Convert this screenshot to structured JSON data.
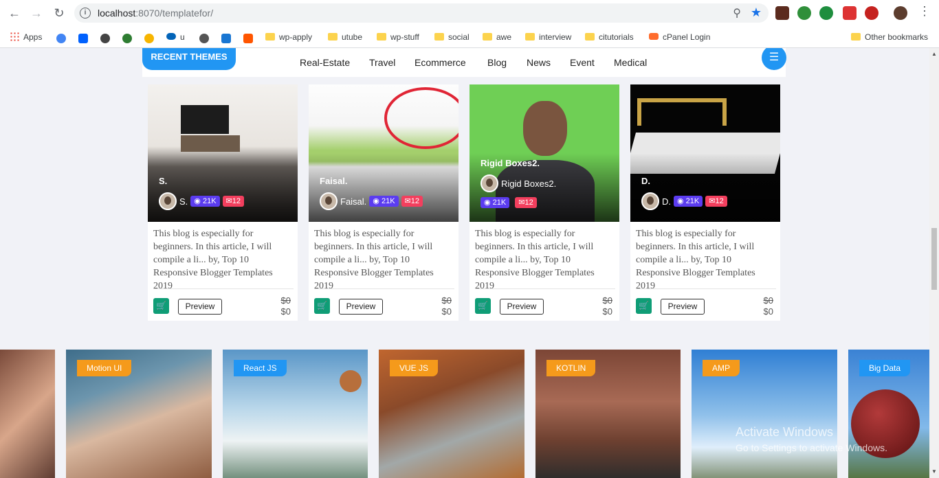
{
  "browser": {
    "url_host": "localhost",
    "url_rest": ":8070/templatefor/"
  },
  "bookmarks": {
    "apps": "Apps",
    "items": [
      "u",
      "wp-apply",
      "utube",
      "wp-stuff",
      "social",
      "awe",
      "interview",
      "citutorials",
      "cPanel Login"
    ],
    "other": "Other bookmarks"
  },
  "themes": {
    "recent_label": "RECENT THEMES",
    "categories": [
      "Real-Estate",
      "Travel",
      "Ecommerce",
      "Blog",
      "News",
      "Event",
      "Medical"
    ]
  },
  "cards": [
    {
      "name": "S.",
      "author": "S.",
      "views": "21K",
      "comments": "12",
      "desc": "This blog is especially for beginners. In this article, I will compile a li... by, Top 10 Responsive Blogger Templates 2019",
      "preview": "Preview",
      "old_price": "$0",
      "price": "$0"
    },
    {
      "name": "Faisal.",
      "author": "Faisal.",
      "views": "21K",
      "comments": "12",
      "desc": "This blog is especially for beginners. In this article, I will compile a li... by, Top 10 Responsive Blogger Templates 2019",
      "preview": "Preview",
      "old_price": "$0",
      "price": "$0"
    },
    {
      "name": "Rigid Boxes2.",
      "author": "Rigid Boxes2.",
      "views": "21K",
      "comments": "12",
      "desc": "This blog is especially for beginners. In this article, I will compile a li... by, Top 10 Responsive Blogger Templates 2019",
      "preview": "Preview",
      "old_price": "$0",
      "price": "$0"
    },
    {
      "name": "D.",
      "author": "D.",
      "views": "21K",
      "comments": "12",
      "desc": "This blog is especially for beginners. In this article, I will compile a li... by, Top 10 Responsive Blogger Templates 2019",
      "preview": "Preview",
      "old_price": "$0",
      "price": "$0"
    }
  ],
  "tech_categories": [
    "Motion UI",
    "React JS",
    "VUE JS",
    "KOTLIN",
    "AMP",
    "Big Data"
  ],
  "watermark": {
    "title": "Activate Windows",
    "sub": "Go to Settings to activate Windows."
  },
  "colors": {
    "accent": "#2196f3",
    "views_badge": "#5b3cf0",
    "comments_badge": "#f33f5e",
    "cart": "#0f9d76",
    "tag_orange": "#f59a1b"
  }
}
